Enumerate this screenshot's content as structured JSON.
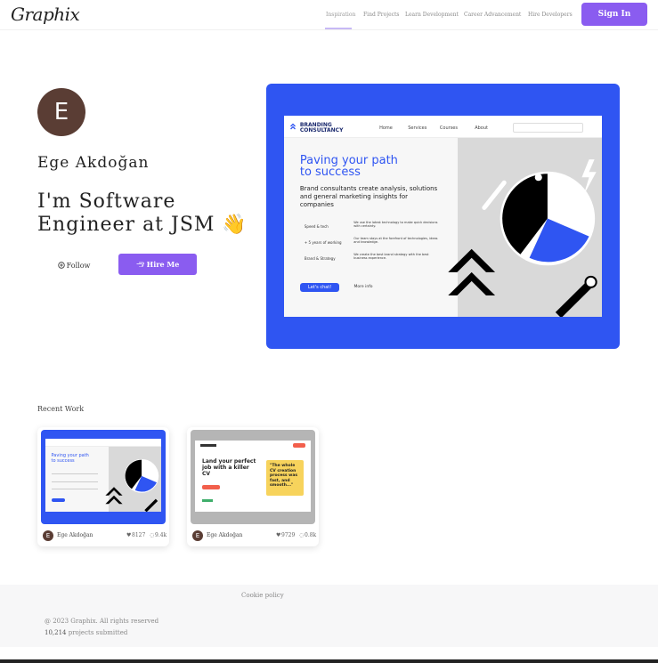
{
  "header": {
    "logo": "Graphix",
    "nav": [
      "Inspiration",
      "Find Projects",
      "Learn Development",
      "Career Advancement",
      "Hire Developers"
    ],
    "sign_in": "Sign In"
  },
  "profile": {
    "avatar_letter": "E",
    "name": "Ege Akdoğan",
    "headline": "I'm Software Engineer at JSM 👋",
    "follow_label": "Follow",
    "hire_label": "Hire Me"
  },
  "hero_mockup": {
    "brand_line1": "BRANDING",
    "brand_line2": "CONSULTANCY",
    "links": [
      "Home",
      "Services",
      "Courses",
      "About"
    ],
    "heading_line1": "Paving your path",
    "heading_line2": "to success",
    "paragraph": "Brand consultants create analysis, solutions and general marketing insights for companies",
    "rows": [
      {
        "label": "Speed & tech",
        "text": "We use the latest technology to make quick decisions with certainty."
      },
      {
        "label": "+ 5 years of working",
        "text": "Our team stays at the forefront of technologies, ideas and knowledge."
      },
      {
        "label": "Brand & Strategy",
        "text": "We create the best brand strategy with the best business experience."
      }
    ],
    "cta": "Let's chat!",
    "more": "More info"
  },
  "recent": {
    "title": "Recent Work",
    "cards": [
      {
        "author": "Ege Akdoğan",
        "avatar_letter": "E",
        "likes": "8127",
        "views": "9.4k"
      },
      {
        "author": "Ege Akdoğan",
        "avatar_letter": "E",
        "likes": "9729",
        "views": "0.8k"
      }
    ],
    "card2_mockup": {
      "heading": "Land your perfect job with a killer CV",
      "quote": "\"The whole CV creation process was fast, and smooth...\""
    }
  },
  "footer": {
    "cookie": "Cookie policy",
    "copyright": "@ 2023 Graphix. All rights reserved",
    "count": "10,214",
    "count_suffix": " projects submitted"
  },
  "colors": {
    "accent": "#8a5cf0",
    "hero_blue": "#2f55f2",
    "avatar_brown": "#5a3d34"
  }
}
